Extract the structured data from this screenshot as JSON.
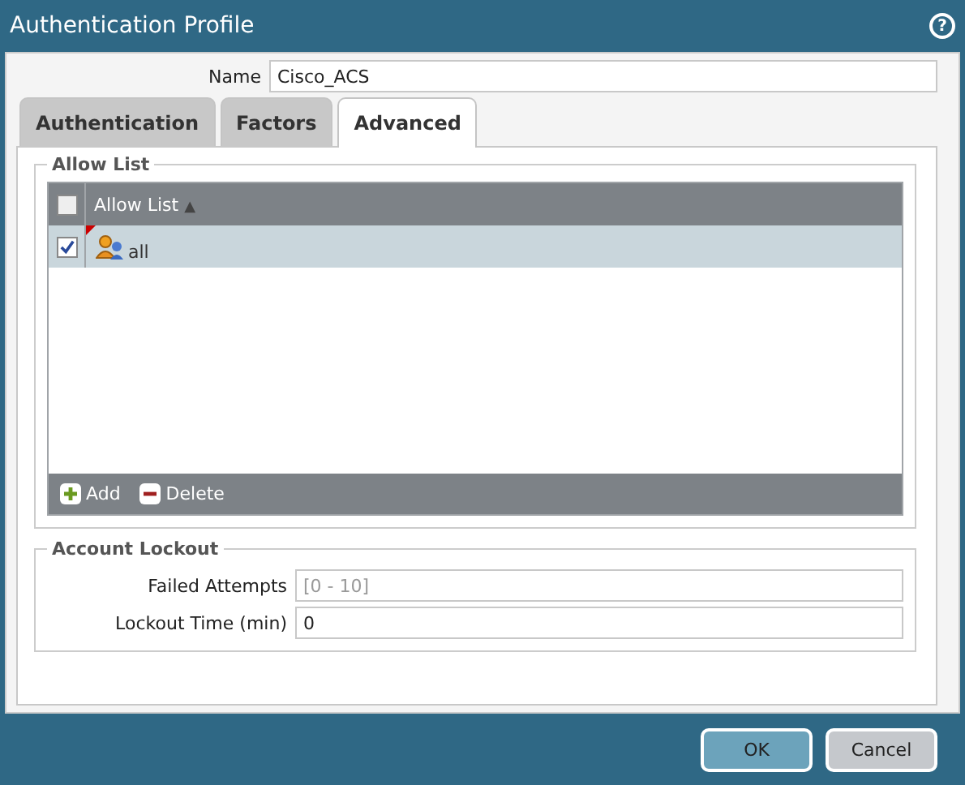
{
  "window": {
    "title": "Authentication Profile",
    "help": "?"
  },
  "name_field": {
    "label": "Name",
    "value": "Cisco_ACS"
  },
  "tabs": [
    {
      "label": "Authentication",
      "selected": false
    },
    {
      "label": "Factors",
      "selected": false
    },
    {
      "label": "Advanced",
      "selected": true
    }
  ],
  "allow_list": {
    "legend": "Allow List",
    "header_checked": false,
    "column": "Allow List",
    "sort": "▲",
    "rows": [
      {
        "name": "all",
        "checked": true,
        "selected": true
      }
    ],
    "actions": [
      {
        "kind": "add",
        "label": "Add"
      },
      {
        "kind": "delete",
        "label": "Delete"
      }
    ]
  },
  "account_lockout": {
    "legend": "Account Lockout",
    "fields": [
      {
        "label": "Failed Attempts",
        "placeholder": "[0 - 10]"
      },
      {
        "label": "Lockout Time (min)",
        "value": "0"
      }
    ]
  },
  "buttons": [
    {
      "label": "OK",
      "primary": true
    },
    {
      "label": "Cancel",
      "primary": false
    }
  ]
}
